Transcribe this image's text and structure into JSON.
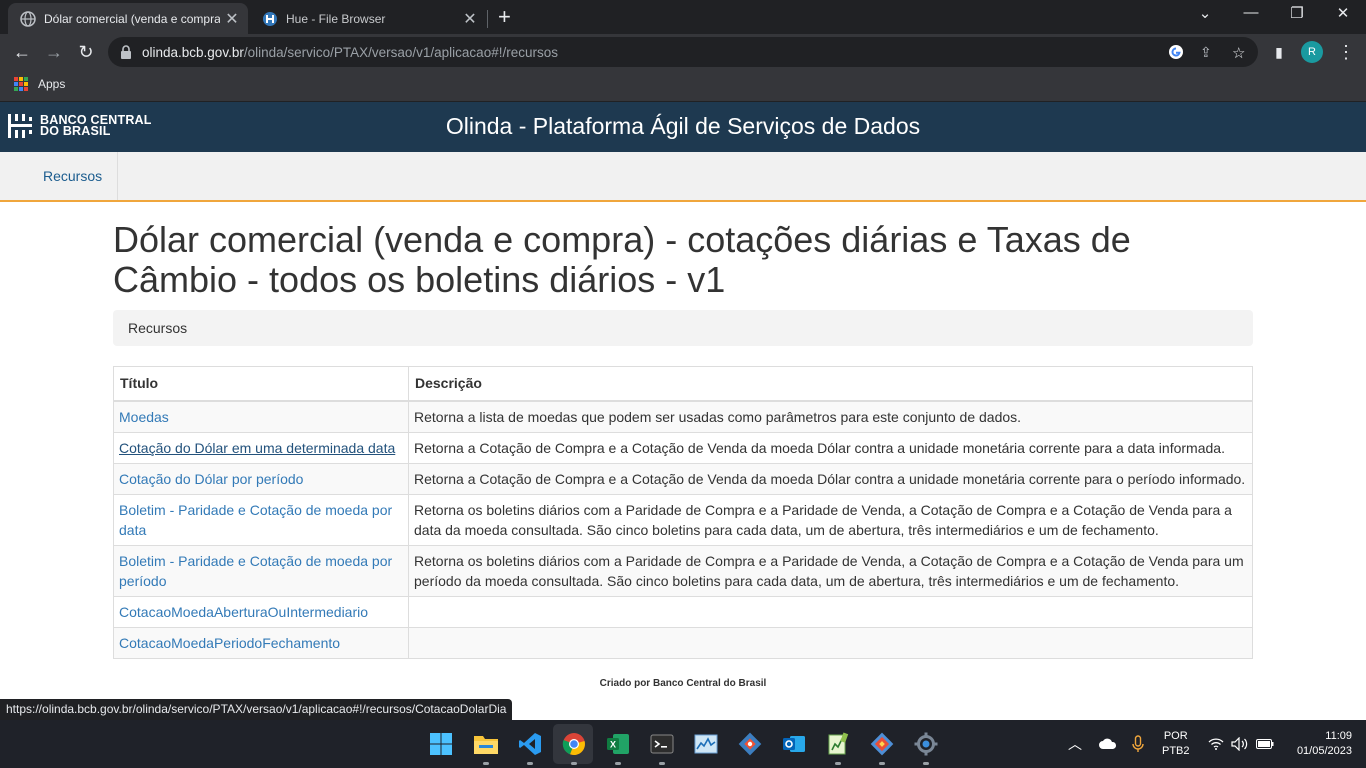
{
  "browser": {
    "tabs": [
      {
        "title": "Dólar comercial (venda e compra) - cotações diárias e Taxas de Câmbio",
        "active": true,
        "favicon": "globe-icon"
      },
      {
        "title": "Hue - File Browser",
        "active": false,
        "favicon": "hue-icon"
      }
    ],
    "url": {
      "host": "olinda.bcb.gov.br",
      "path": "/olinda/servico/PTAX/versao/v1/aplicacao#!/recursos"
    },
    "avatar_initial": "R",
    "bookmarks": {
      "apps_label": "Apps"
    }
  },
  "site": {
    "logo_line1": "BANCO CENTRAL",
    "logo_line2": "DO BRASIL",
    "header_title": "Olinda - Plataforma Ágil de Serviços de Dados",
    "nav": [
      {
        "label": "Recursos"
      }
    ]
  },
  "main": {
    "title": "Dólar comercial (venda e compra) - cotações diárias e Taxas de Câmbio - todos os boletins diários - v1",
    "breadcrumb": "Recursos",
    "table": {
      "headers": [
        "Título",
        "Descrição"
      ],
      "rows": [
        {
          "title": "Moedas",
          "description": "Retorna a lista de moedas que podem ser usadas como parâmetros para este conjunto de dados."
        },
        {
          "title": "Cotação do Dólar em uma determinada data",
          "description": "Retorna a Cotação de Compra e a Cotação de Venda da moeda Dólar contra a unidade monetária corrente para a data informada."
        },
        {
          "title": "Cotação do Dólar por período",
          "description": "Retorna a Cotação de Compra e a Cotação de Venda da moeda Dólar contra a unidade monetária corrente para o período informado."
        },
        {
          "title": "Boletim - Paridade e Cotação de moeda por data",
          "description": "Retorna os boletins diários com a Paridade de Compra e a Paridade de Venda, a Cotação de Compra e a Cotação de Venda para a data da moeda consultada. São cinco boletins para cada data, um de abertura, três intermediários e um de fechamento."
        },
        {
          "title": "Boletim - Paridade e Cotação de moeda por período",
          "description": "Retorna os boletins diários com a Paridade de Compra e a Paridade de Venda, a Cotação de Compra e a Cotação de Venda para um período da moeda consultada. São cinco boletins para cada data, um de abertura, três intermediários e um de fechamento."
        },
        {
          "title": "CotacaoMoedaAberturaOuIntermediario",
          "description": ""
        },
        {
          "title": "CotacaoMoedaPeriodoFechamento",
          "description": ""
        }
      ]
    },
    "footer": "Criado por Banco Central do Brasil"
  },
  "status_bar": "https://olinda.bcb.gov.br/olinda/servico/PTAX/versao/v1/aplicacao#!/recursos/CotacaoDolarDia",
  "taskbar": {
    "apps": [
      "windows-start-icon",
      "file-explorer-icon",
      "vscode-icon",
      "chrome-icon",
      "excel-icon",
      "terminal-icon",
      "resource-monitor-icon",
      "git-icon",
      "outlook-icon",
      "notepad-plus-icon",
      "git-extensions-icon",
      "settings-icon"
    ],
    "language": "POR",
    "layout": "PTB2",
    "time": "11:09",
    "date": "01/05/2023"
  },
  "colors": {
    "header_bg": "#1e3950",
    "link": "#337ab7",
    "nav_accent": "#f0a63c"
  }
}
